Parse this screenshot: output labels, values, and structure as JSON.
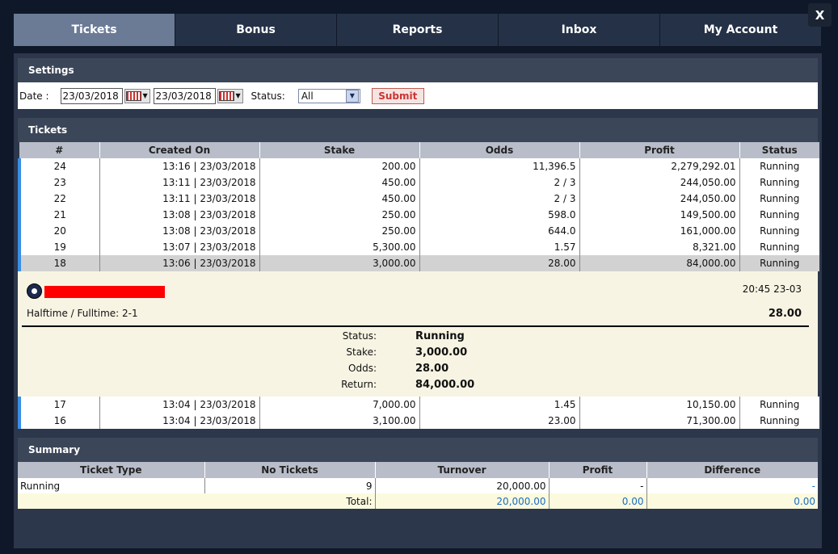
{
  "tabs": [
    "Tickets",
    "Bonus",
    "Reports",
    "Inbox",
    "My Account"
  ],
  "close_label": "X",
  "settings": {
    "title": "Settings",
    "date_label": "Date :",
    "date_from": "23/03/2018",
    "date_to": "23/03/2018",
    "status_label": "Status:",
    "status_value": "All",
    "submit_label": "Submit"
  },
  "tickets": {
    "title": "Tickets",
    "headers": [
      "#",
      "Created On",
      "Stake",
      "Odds",
      "Profit",
      "Status"
    ],
    "rows": [
      {
        "id": "24",
        "created": "13:16 | 23/03/2018",
        "stake": "200.00",
        "odds": "11,396.5",
        "profit": "2,279,292.01",
        "status": "Running"
      },
      {
        "id": "23",
        "created": "13:11 | 23/03/2018",
        "stake": "450.00",
        "odds": "2 / 3",
        "profit": "244,050.00",
        "status": "Running"
      },
      {
        "id": "22",
        "created": "13:11 | 23/03/2018",
        "stake": "450.00",
        "odds": "2 / 3",
        "profit": "244,050.00",
        "status": "Running"
      },
      {
        "id": "21",
        "created": "13:08 | 23/03/2018",
        "stake": "250.00",
        "odds": "598.0",
        "profit": "149,500.00",
        "status": "Running"
      },
      {
        "id": "20",
        "created": "13:08 | 23/03/2018",
        "stake": "250.00",
        "odds": "644.0",
        "profit": "161,000.00",
        "status": "Running"
      },
      {
        "id": "19",
        "created": "13:07 | 23/03/2018",
        "stake": "5,300.00",
        "odds": "1.57",
        "profit": "8,321.00",
        "status": "Running"
      },
      {
        "id": "18",
        "created": "13:06 | 23/03/2018",
        "stake": "3,000.00",
        "odds": "28.00",
        "profit": "84,000.00",
        "status": "Running"
      }
    ],
    "rows_after": [
      {
        "id": "17",
        "created": "13:04 | 23/03/2018",
        "stake": "7,000.00",
        "odds": "1.45",
        "profit": "10,150.00",
        "status": "Running"
      },
      {
        "id": "16",
        "created": "13:04 | 23/03/2018",
        "stake": "3,100.00",
        "odds": "23.00",
        "profit": "71,300.00",
        "status": "Running"
      }
    ]
  },
  "detail": {
    "sport_icon": "soccer-ball-icon",
    "time": "20:45 23-03",
    "market": "Halftime / Fulltime: 2-1",
    "odds": "28.00",
    "status_label": "Status:",
    "status": "Running",
    "stake_label": "Stake:",
    "stake": "3,000.00",
    "odds_label": "Odds:",
    "odds_value": "28.00",
    "return_label": "Return:",
    "return": "84,000.00",
    "redaction_color": "#ff0000"
  },
  "summary": {
    "title": "Summary",
    "headers": [
      "Ticket Type",
      "No Tickets",
      "Turnover",
      "Profit",
      "Difference"
    ],
    "row": {
      "type": "Running",
      "count": "9",
      "turnover": "20,000.00",
      "profit": "-",
      "difference": "-"
    },
    "total": {
      "label": "Total:",
      "turnover": "20,000.00",
      "profit": "0.00",
      "difference": "0.00"
    }
  },
  "colors": {
    "accent_blue": "#3a8ee6",
    "link_blue": "#1b6dc1",
    "submit_red": "#cc3333"
  }
}
